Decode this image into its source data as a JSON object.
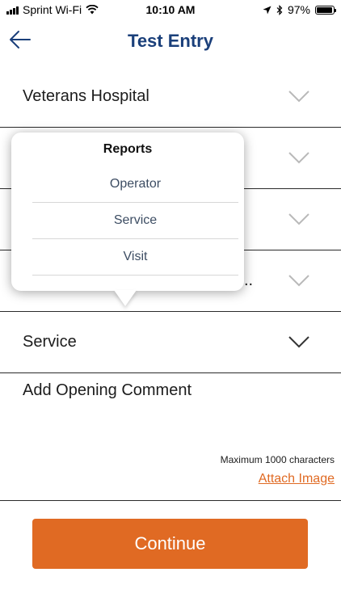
{
  "status_bar": {
    "carrier": "Sprint Wi-Fi",
    "time": "10:10 AM",
    "battery": "97%",
    "battery_level": 0.97
  },
  "header": {
    "title": "Test Entry"
  },
  "rows": [
    {
      "label": "Veterans Hospital"
    },
    {
      "label": ""
    },
    {
      "label": ""
    },
    {
      "label": ""
    },
    {
      "label": "Service"
    }
  ],
  "row_partial_text": "..",
  "popover": {
    "title": "Reports",
    "items": [
      {
        "label": "Operator"
      },
      {
        "label": "Service"
      },
      {
        "label": "Visit"
      }
    ]
  },
  "comment": {
    "placeholder": "Add Opening Comment",
    "max_chars_text": "Maximum 1000 characters",
    "attach_label": "Attach Image"
  },
  "footer": {
    "continue_label": "Continue"
  },
  "colors": {
    "accent": "#e06a23",
    "title": "#1a3f7a",
    "chevron_dim": "#b9b9b9",
    "chevron_dark": "#333333"
  }
}
